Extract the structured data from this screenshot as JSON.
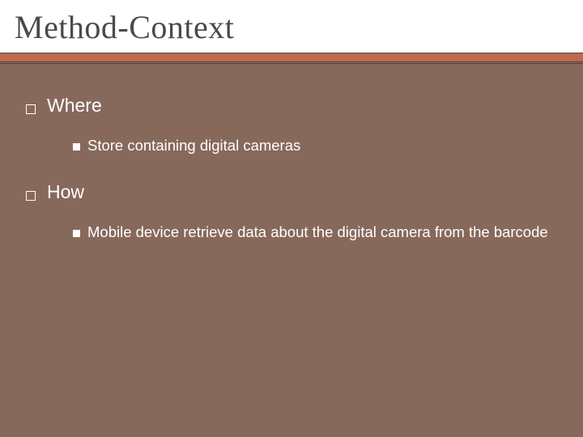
{
  "title": "Method-Context",
  "items": [
    {
      "label": "Where",
      "sub": "Store containing digital cameras"
    },
    {
      "label": "How",
      "sub": "Mobile device retrieve data about the digital camera from the barcode"
    }
  ]
}
